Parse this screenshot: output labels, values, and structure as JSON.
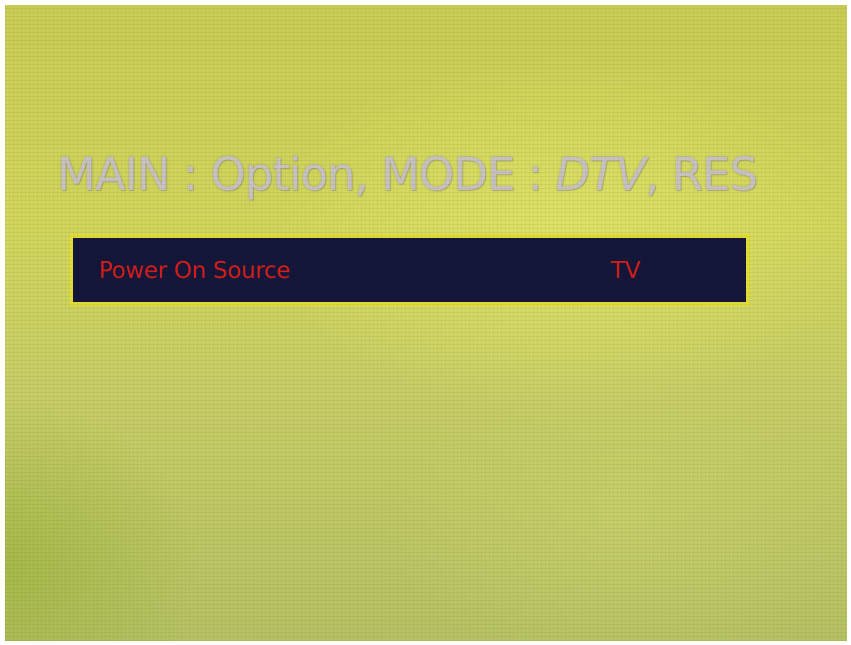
{
  "screen": {
    "status_prefix": "MAIN : Option, MODE : ",
    "status_mode": "DTV",
    "status_suffix": ", RES"
  },
  "menu": {
    "items": [
      {
        "label": "Power On Source",
        "value": "TV"
      }
    ]
  },
  "colors": {
    "background": "#cdd25c",
    "panel_border": "#e2dc3a",
    "panel_fill": "#15173a",
    "highlight_text": "#d61e1a",
    "status_text": "#c9c2c2"
  }
}
